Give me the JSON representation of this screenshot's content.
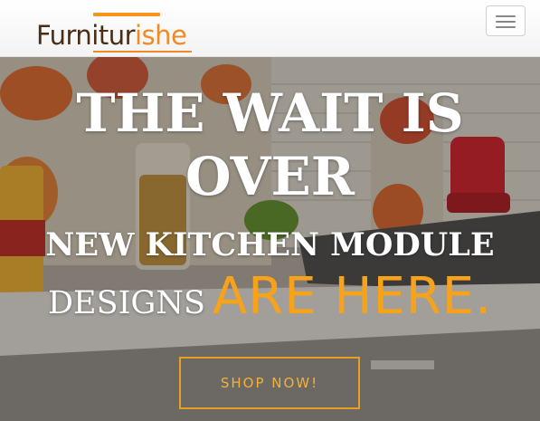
{
  "navbar": {
    "logo": {
      "part1": "Furnitur",
      "part2": "ishe"
    },
    "menu_toggle_icon": "hamburger-icon"
  },
  "hero": {
    "headline_line1": "THE WAIT IS",
    "headline_line2": "OVER",
    "subheadline_line1": "NEW KITCHEN MODULE",
    "subheadline_line2_white": "DESIGNS",
    "subheadline_line2_accent": "ARE HERE.",
    "cta_label": "SHOP NOW!"
  },
  "colors": {
    "accent": "#f7a21b",
    "logo_brown": "#4a2c17",
    "cta_border": "#e8a020"
  }
}
